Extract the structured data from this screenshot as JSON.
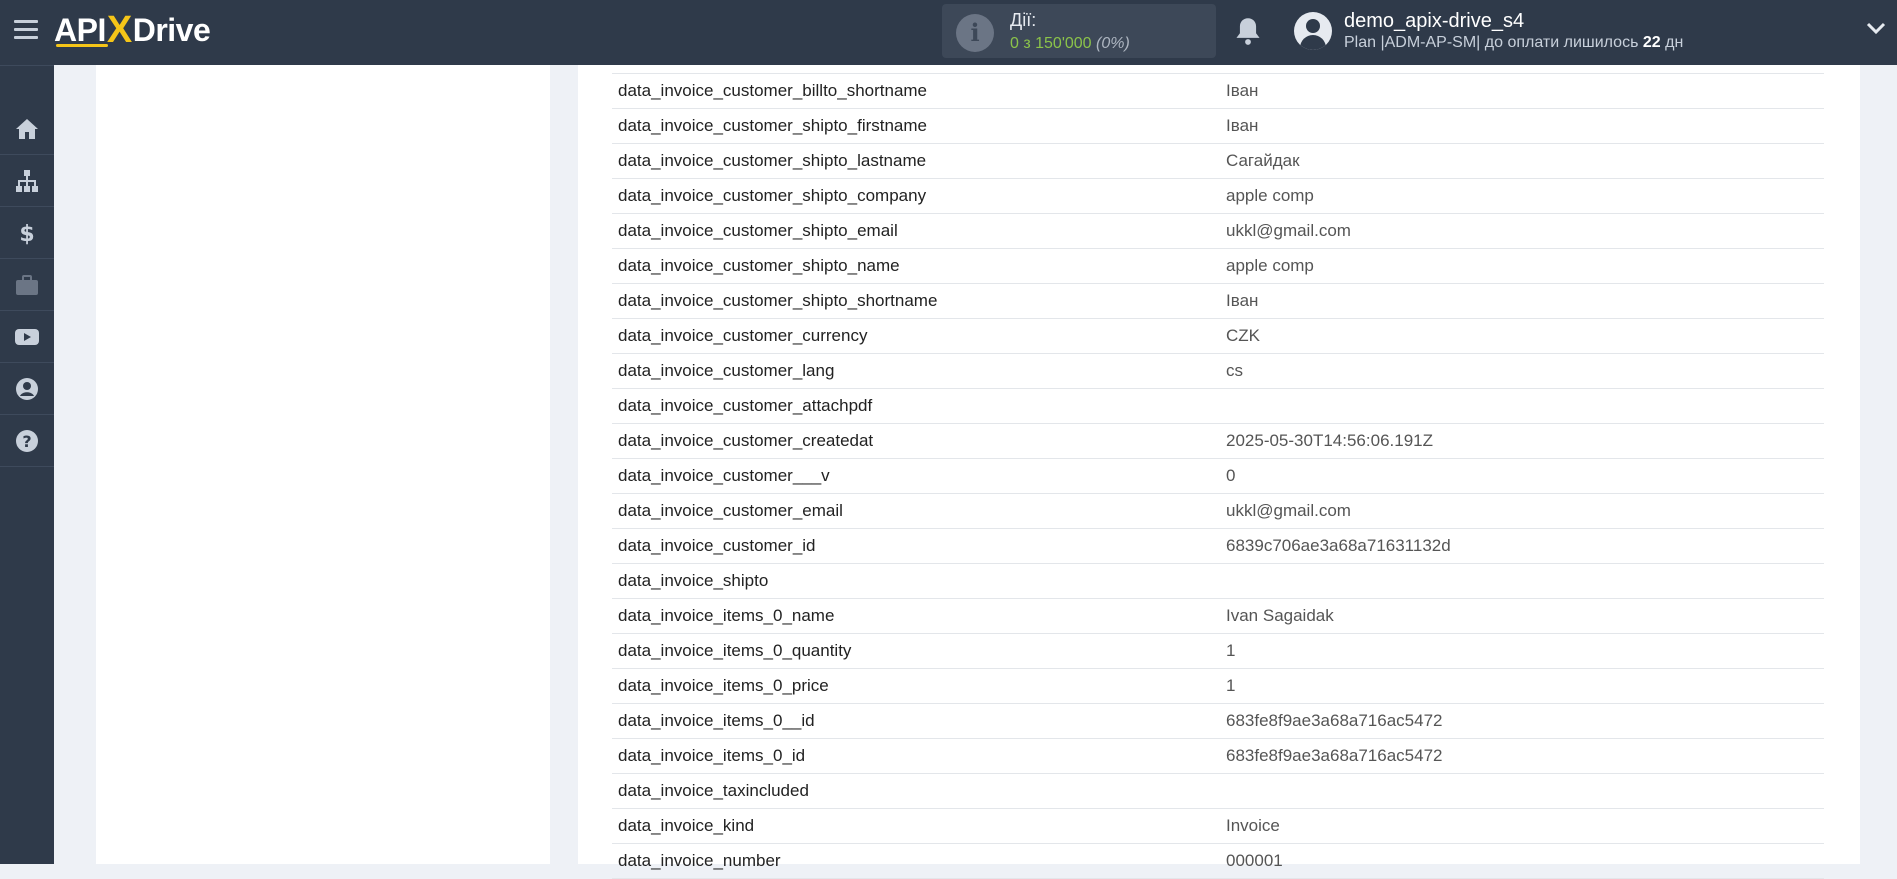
{
  "header": {
    "logo": {
      "part1": "API",
      "part2": "X",
      "part3": "Drive"
    },
    "actions": {
      "label": "Дії:",
      "count": "0 з 150'000",
      "percent": "(0%)"
    },
    "user": {
      "name": "demo_apix-drive_s4",
      "plan_prefix": "Plan |ADM-AP-SM| до оплати лишилось ",
      "days": "22",
      "days_suffix": " дн"
    }
  },
  "sidebar": {
    "items": [
      "home-icon",
      "sitemap-icon",
      "dollar-icon",
      "briefcase-icon",
      "youtube-icon",
      "user-icon",
      "help-icon"
    ]
  },
  "colors": {
    "topbar": "#2f3a4a",
    "accent": "#f5c518",
    "count_green": "#8bc34a"
  },
  "rows": [
    {
      "key": "data_invoice_customer_billto_shortname",
      "value": "Іван"
    },
    {
      "key": "data_invoice_customer_shipto_firstname",
      "value": "Іван"
    },
    {
      "key": "data_invoice_customer_shipto_lastname",
      "value": "Сагайдак"
    },
    {
      "key": "data_invoice_customer_shipto_company",
      "value": "apple comp"
    },
    {
      "key": "data_invoice_customer_shipto_email",
      "value": "ukkl@gmail.com"
    },
    {
      "key": "data_invoice_customer_shipto_name",
      "value": "apple comp"
    },
    {
      "key": "data_invoice_customer_shipto_shortname",
      "value": "Іван"
    },
    {
      "key": "data_invoice_customer_currency",
      "value": "CZK"
    },
    {
      "key": "data_invoice_customer_lang",
      "value": "cs"
    },
    {
      "key": "data_invoice_customer_attachpdf",
      "value": ""
    },
    {
      "key": "data_invoice_customer_createdat",
      "value": "2025-05-30T14:56:06.191Z"
    },
    {
      "key": "data_invoice_customer___v",
      "value": "0"
    },
    {
      "key": "data_invoice_customer_email",
      "value": "ukkl@gmail.com"
    },
    {
      "key": "data_invoice_customer_id",
      "value": "6839c706ae3a68a71631132d"
    },
    {
      "key": "data_invoice_shipto",
      "value": ""
    },
    {
      "key": "data_invoice_items_0_name",
      "value": "Ivan Sagaidak"
    },
    {
      "key": "data_invoice_items_0_quantity",
      "value": "1"
    },
    {
      "key": "data_invoice_items_0_price",
      "value": "1"
    },
    {
      "key": "data_invoice_items_0__id",
      "value": "683fe8f9ae3a68a716ac5472"
    },
    {
      "key": "data_invoice_items_0_id",
      "value": "683fe8f9ae3a68a716ac5472"
    },
    {
      "key": "data_invoice_taxincluded",
      "value": ""
    },
    {
      "key": "data_invoice_kind",
      "value": "Invoice"
    },
    {
      "key": "data_invoice_number",
      "value": "000001"
    }
  ]
}
